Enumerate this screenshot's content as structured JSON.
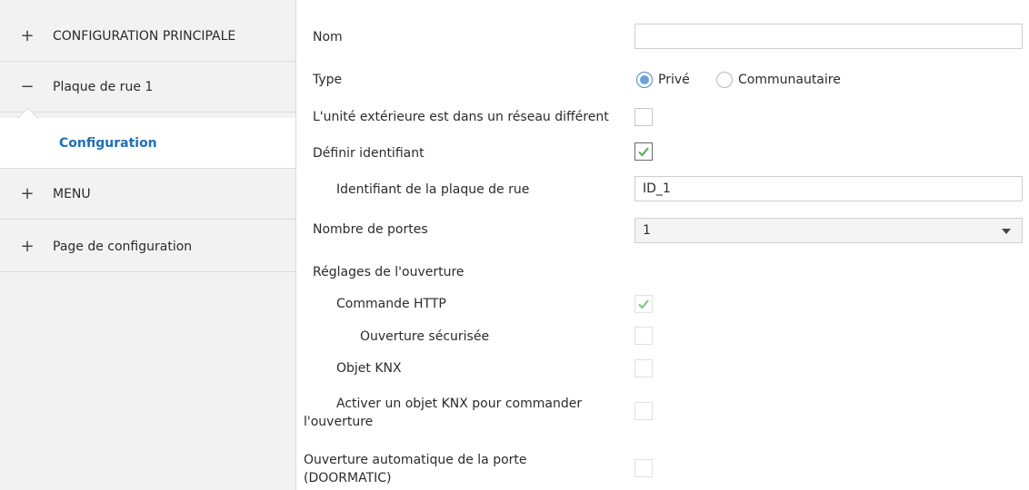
{
  "sidebar": {
    "items": [
      {
        "sign": "+",
        "label": "CONFIGURATION PRINCIPALE"
      },
      {
        "sign": "−",
        "label": "Plaque de rue 1"
      },
      {
        "sign": "",
        "label": "Configuration"
      },
      {
        "sign": "+",
        "label": "MENU"
      },
      {
        "sign": "+",
        "label": "Page de configuration"
      }
    ]
  },
  "form": {
    "name_label": "Nom",
    "name_value": "",
    "type_label": "Type",
    "type_options": [
      "Privé",
      "Communautaire"
    ],
    "type_selected": "Privé",
    "external_unit_label": "L'unité extérieure est dans un réseau différent",
    "external_unit_checked": false,
    "define_id_label": "Définir identifiant",
    "define_id_checked": true,
    "plate_id_label": "Identifiant de la plaque de rue",
    "plate_id_value": "ID_1",
    "doors_label": "Nombre de portes",
    "doors_value": "1",
    "opening_settings_label": "Réglages de l'ouverture",
    "http_label": "Commande HTTP",
    "http_checked": true,
    "secure_opening_label": "Ouverture sécurisée",
    "secure_opening_checked": false,
    "knx_object_label": "Objet KNX",
    "knx_object_checked": false,
    "activate_knx_label_line1": "Activer un objet KNX pour commander",
    "activate_knx_label_line2": "l'ouverture",
    "activate_knx_checked": false,
    "doormatic_label_line1": "Ouverture automatique de la porte",
    "doormatic_label_line2": "(DOORMATIC)",
    "doormatic_checked": false
  },
  "colors": {
    "accent": "#1f6fb5",
    "check_green": "#4caf50",
    "sidebar_bg": "#f2f2f2"
  }
}
